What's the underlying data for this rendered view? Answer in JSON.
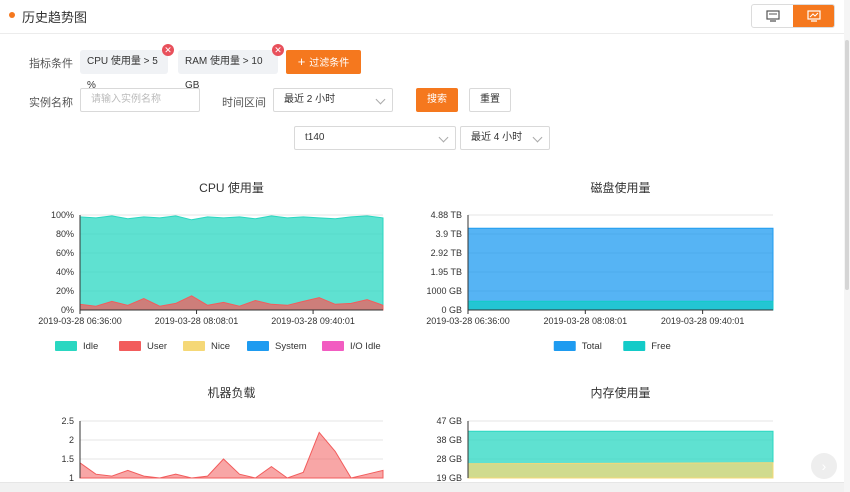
{
  "header": {
    "title": "历史趋势图"
  },
  "filters": {
    "metric_label": "指标条件",
    "chips": [
      {
        "text": "CPU 使用量 > 5 %"
      },
      {
        "text": "RAM 使用量 > 10 GB"
      }
    ],
    "add_button": "过滤条件",
    "add_icon": "+",
    "remove_icon": "✕",
    "instance_label": "实例名称",
    "instance_placeholder": "请输入实例名称",
    "time_label": "时间区间",
    "time_value": "最近 2 小时",
    "search_button": "搜索",
    "reset_button": "重置",
    "host_value": "t140",
    "range_value": "最近 4 小时"
  },
  "colors": {
    "accent": "#f5781e",
    "idle": "#2ad7c1",
    "user": "#f25c5c",
    "nice": "#f5d877",
    "system": "#1e9bf0",
    "io_idle": "#f25cc1",
    "total": "#1e9bf0",
    "free": "#13cbc8"
  },
  "chart_data": [
    {
      "type": "area",
      "title": "CPU 使用量",
      "yticks": [
        "0%",
        "20%",
        "40%",
        "60%",
        "80%",
        "100%"
      ],
      "ylim": [
        0,
        100
      ],
      "xticks": [
        "2019-03-28 06:36:00",
        "2019-03-28 08:08:01",
        "2019-03-28 09:40:01"
      ],
      "series": [
        {
          "name": "Idle",
          "values": [
            98,
            97,
            99,
            96,
            98,
            97,
            99,
            95,
            98,
            97,
            98,
            96,
            99,
            97,
            98,
            97,
            96,
            98,
            99,
            97
          ]
        },
        {
          "name": "User",
          "values": [
            6,
            4,
            9,
            5,
            12,
            4,
            7,
            15,
            5,
            8,
            4,
            10,
            6,
            5,
            9,
            13,
            6,
            7,
            11,
            5
          ]
        },
        {
          "name": "Nice",
          "values": []
        },
        {
          "name": "System",
          "values": []
        },
        {
          "name": "I/O Idle",
          "values": []
        }
      ],
      "legend": [
        "Idle",
        "User",
        "Nice",
        "System",
        "I/O Idle"
      ]
    },
    {
      "type": "area",
      "title": "磁盘使用量",
      "yticks": [
        "0 GB",
        "1000 GB",
        "1.95 TB",
        "2.92 TB",
        "3.9 TB",
        "4.88 TB"
      ],
      "ylim": [
        0,
        4.88
      ],
      "xticks": [
        "2019-03-28 06:36:00",
        "2019-03-28 08:08:01",
        "2019-03-28 09:40:01"
      ],
      "series": [
        {
          "name": "Total",
          "values": [
            4.2,
            4.2
          ]
        },
        {
          "name": "Free",
          "values": [
            0.45,
            0.45
          ]
        }
      ],
      "legend": [
        "Total",
        "Free"
      ]
    },
    {
      "type": "line",
      "title": "机器负载",
      "yticks": [
        "1",
        "1.5",
        "2",
        "2.5"
      ],
      "ylim": [
        1,
        2.5
      ],
      "series": [
        {
          "name": "",
          "values": [
            1.4,
            1.1,
            1.05,
            1.2,
            1.05,
            1.0,
            1.1,
            1.0,
            1.05,
            1.5,
            1.1,
            1.0,
            1.3,
            1.0,
            1.15,
            2.2,
            1.7,
            1.0,
            1.1,
            1.2
          ]
        }
      ]
    },
    {
      "type": "area",
      "title": "内存使用量",
      "yticks": [
        "19 GB",
        "28 GB",
        "38 GB",
        "47 GB"
      ],
      "ylim": [
        19,
        47
      ],
      "series": [
        {
          "name": "",
          "values": [
            42,
            42
          ]
        },
        {
          "name": "",
          "values": [
            26,
            26.5
          ]
        }
      ]
    }
  ]
}
